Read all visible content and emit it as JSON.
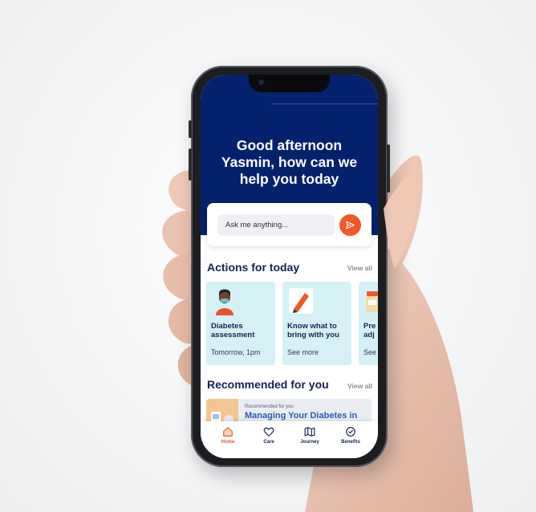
{
  "hero": {
    "greeting_line1": "Good afternoon",
    "greeting_line2": "Yasmin, how can we",
    "greeting_line3": "help you today"
  },
  "ask": {
    "placeholder": "Ask me anything...",
    "send_icon": "send-icon"
  },
  "actions": {
    "title": "Actions for today",
    "view_all": "View all",
    "cards": [
      {
        "title": "Diabetes assessment",
        "subtitle": "Tomorrow, 1pm",
        "icon": "person-mask-icon"
      },
      {
        "title": "Know what to bring with you",
        "subtitle": "See more",
        "icon": "pencil-icon"
      },
      {
        "title": "Pre adj",
        "subtitle": "See",
        "icon": "pill-bottle-icon"
      }
    ]
  },
  "recommended": {
    "title": "Recommended for you",
    "view_all": "View all",
    "card": {
      "kicker": "Recommended for you",
      "title": "Managing Your Diabetes in"
    }
  },
  "tabbar": {
    "tabs": [
      {
        "label": "Home",
        "icon": "home-icon",
        "active": true
      },
      {
        "label": "Care",
        "icon": "heart-icon",
        "active": false
      },
      {
        "label": "Journey",
        "icon": "map-icon",
        "active": false
      },
      {
        "label": "Benefits",
        "icon": "badge-check-icon",
        "active": false
      }
    ]
  },
  "colors": {
    "hero_bg": "#04216e",
    "accent": "#f2572b",
    "card_bg": "#d6f1f6",
    "heading": "#16234f"
  }
}
